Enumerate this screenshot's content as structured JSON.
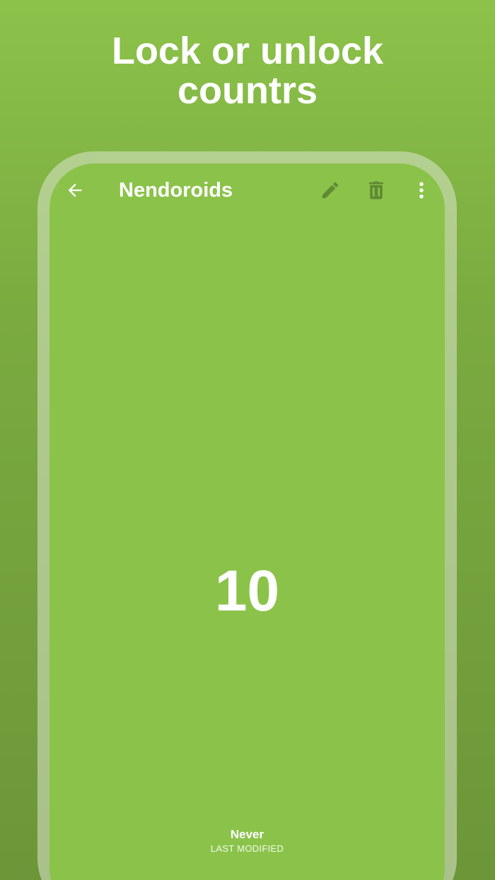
{
  "headline": {
    "line1": "Lock or unlock",
    "line2": "countrs"
  },
  "toolbar": {
    "back_icon": "arrow-back-icon",
    "title": "Nendoroids",
    "edit_icon": "pencil-icon",
    "delete_icon": "trash-icon",
    "more_icon": "more-vert-icon"
  },
  "counter": {
    "value": "10"
  },
  "footer": {
    "modified_value": "Never",
    "modified_label": "LAST MODIFIED"
  },
  "colors": {
    "background_top": "#8cc24a",
    "background_bottom": "#6c9638",
    "screen": "#8bc34a",
    "icon_muted": "#5f8a33",
    "text": "#ffffff"
  }
}
